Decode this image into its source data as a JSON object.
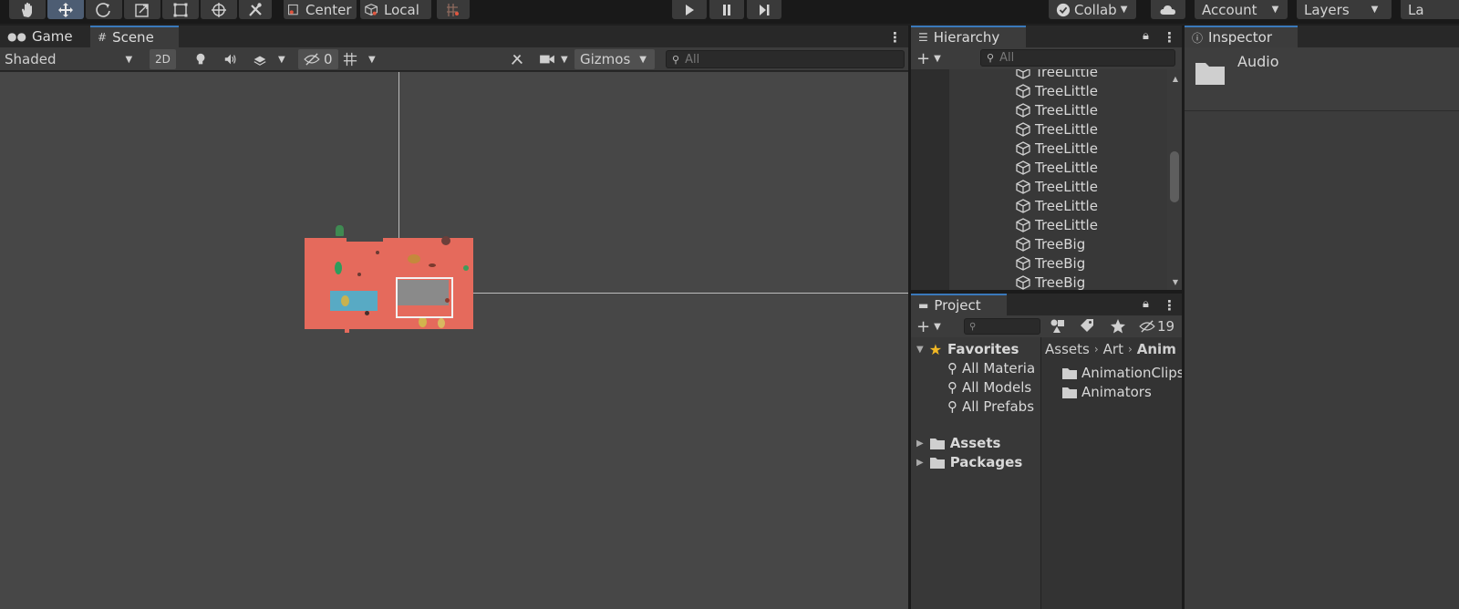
{
  "toolbar": {
    "pivot_label": "Center",
    "space_label": "Local",
    "collab_label": "Collab",
    "account_label": "Account",
    "layers_label": "Layers",
    "layout_label": "La"
  },
  "scene": {
    "tabs": [
      {
        "label": "Game",
        "icon": "gamepad-icon"
      },
      {
        "label": "Scene",
        "icon": "grid-icon"
      }
    ],
    "draw_mode": "Shaded",
    "mode_2d": "2D",
    "hidden_count": "0",
    "gizmos_label": "Gizmos",
    "search_placeholder": "All"
  },
  "hierarchy": {
    "tab_label": "Hierarchy",
    "search_placeholder": "All",
    "items": [
      "TreeLittle",
      "TreeLittle",
      "TreeLittle",
      "TreeLittle",
      "TreeLittle",
      "TreeLittle",
      "TreeLittle",
      "TreeLittle",
      "TreeLittle",
      "TreeBig",
      "TreeBig",
      "TreeBig"
    ]
  },
  "project": {
    "tab_label": "Project",
    "hidden_count": "19",
    "favorites": {
      "label": "Favorites",
      "items": [
        "All Materia",
        "All Models",
        "All Prefabs"
      ]
    },
    "roots": [
      "Assets",
      "Packages"
    ],
    "breadcrumb": [
      "Assets",
      "Art",
      "Anim"
    ],
    "folders": [
      "AnimationClips",
      "Animators"
    ]
  },
  "inspector": {
    "tab_label": "Inspector",
    "title": "Audio"
  },
  "colors": {
    "accent": "#3a79bb",
    "map": "#e56a5c",
    "star": "#f2b824"
  }
}
